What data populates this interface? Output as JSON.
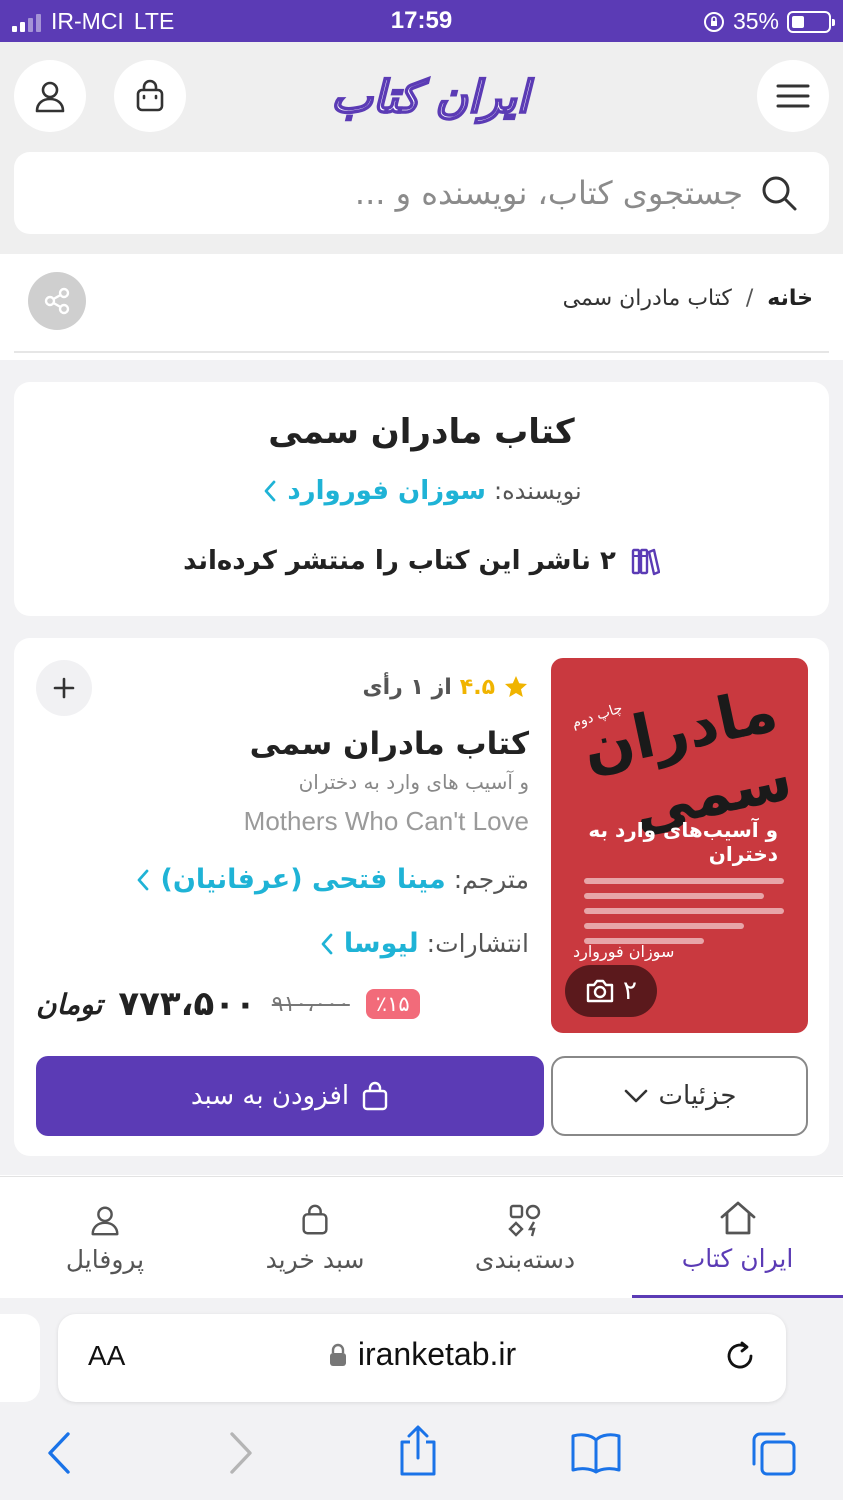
{
  "status_bar": {
    "carrier": "IR-MCI",
    "network": "LTE",
    "time": "17:59",
    "battery": "35%",
    "battery_level": 0.35
  },
  "header": {
    "logo_text": "ایران کتاب",
    "search_placeholder": "جستجوی کتاب، نویسنده و ..."
  },
  "breadcrumb": {
    "home": "خانه",
    "separator": "/",
    "current": "کتاب مادران سمی"
  },
  "summary": {
    "title": "کتاب مادران سمی",
    "author_label": "نویسنده:",
    "author": "سوزان فوروارد",
    "publishers_text": "۲ ناشر این کتاب را منتشر کرده‌اند"
  },
  "product": {
    "rating_score": "۴.۵",
    "rating_votes": "از ۱ رأی",
    "title": "کتاب مادران سمی",
    "subtitle": "و آسیب های وارد به دختران",
    "english_title": "Mothers Who Can't Love",
    "translator_label": "مترجم:",
    "translator": "مینا فتحی (عرفانیان)",
    "publisher_label": "انتشارات:",
    "publisher": "لیوسا",
    "discount": "٪۱۵",
    "old_price": "۹۱۰،۰۰۰",
    "price": "۷۷۳،۵۰۰",
    "currency": "تومان",
    "add_to_cart": "افزودن به سبد",
    "details": "جزئیات",
    "photo_count": "۲",
    "cover": {
      "title": "مادران سمی",
      "subtitle": "و آسیب‌های وارد به دختران",
      "edition": "چاپ دوم",
      "author": "سوزان فوروارد"
    }
  },
  "tabs": [
    {
      "label": "پروفایل",
      "icon": "user-icon"
    },
    {
      "label": "سبد خرید",
      "icon": "bag-icon"
    },
    {
      "label": "دسته‌بندی",
      "icon": "category-icon"
    },
    {
      "label": "ایران کتاب",
      "icon": "home-icon",
      "active": true
    }
  ],
  "browser": {
    "text_size": "AA",
    "url": "iranketab.ir"
  },
  "colors": {
    "brand": "#5b3bb5",
    "link": "#1fb3d6",
    "discount": "#f26b7a",
    "rating": "#f0b400"
  }
}
